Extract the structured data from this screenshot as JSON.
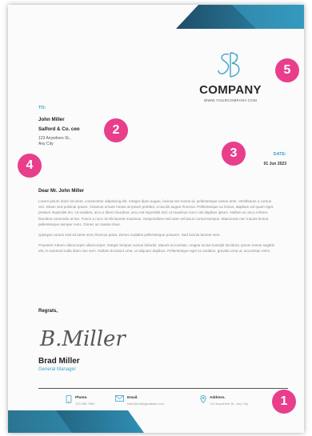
{
  "logo": {
    "company_name": "COMPANY",
    "url": "WWW.YOURCOMPANY.COM"
  },
  "recipient": {
    "label": "TO:",
    "name": "John Miller",
    "company": "Salford & Co. ceo",
    "address_line1": "123 Anywhere St.,",
    "address_line2": "Any City"
  },
  "date": {
    "label": "DATE:",
    "value": "01 Jun 2023"
  },
  "letter": {
    "salutation": "Dear Mr. John Miller",
    "paragraph1": "Lorem ipsum dolor sit amet, consectetur adipiscing elit. Integer diam augue, lacinia nec lectus id, pellentesque varius ante. Vestibulum a cursus orci. Etiam sed pulvinar ipsum. Vivamus ornare metus at ipsum porttitor, a iaculis augue rhoncus. Pellentesque ac lectus, dapibus vel quam eget, pretium imperdiet leo. Ut sodales, arcu a libero faucibus, arcu est imperdiet nisl, ut maximus nunc nisi dapibus ipsum. Nullam ac arcu a libero faucibus commodo at leo. Fusce a nunc id elit laoreet maximus. Suspendisse sed ante vel lacus cursus tempus. Maecenas nec mauris lectus, pellentesque semper nunc. Donec ac massa risus.",
    "paragraph1b": "Quisque cursus erat sit amet eros rhoncus porta. Donec sodales pellentesque posuere. Sed lacinia laoreet sem.",
    "paragraph2": "Praesent rutrum ullamcorper ullamcorper. Integer tempus cursus lobortis. Mauris accumsan, magna luctus suscipit tincidunt, ipsum metus sagittis elit, in euismod nulla diam non sem. Nullam tincidunt urna, ut aliquam dapibus. Pellentesque eget ex sodales, gravida urna ut, accumsan enim.",
    "regards": "Regrats,",
    "signature": "B.Miller",
    "signer_name": "Brad Miller",
    "signer_title": "General Manager"
  },
  "footer": {
    "phone_label": "Phone.",
    "phone_value": "123 456 7890",
    "email_label": "Email.",
    "email_value": "hello@reallygreatsite.com",
    "address_label": "Address.",
    "address_value": "123 Anywhere St., Any City"
  },
  "badges": [
    "1",
    "2",
    "3",
    "4",
    "5"
  ],
  "colors": {
    "accent": "#3aa3c8",
    "dark_teal": "#1e4d66",
    "badge": "#e83e8c"
  },
  "icons": [
    "phone-icon",
    "email-icon",
    "location-icon"
  ]
}
